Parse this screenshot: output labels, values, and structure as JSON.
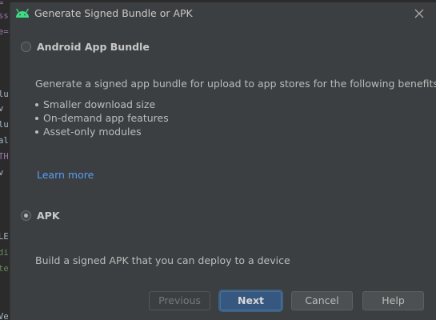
{
  "editor": {
    "fragments": [
      "=",
      "ss",
      "e=",
      "lu",
      "v",
      "lu",
      "al",
      "TH",
      "v",
      "LE",
      "di",
      "te",
      "Ve"
    ]
  },
  "dialog": {
    "title": "Generate Signed Bundle or APK",
    "options": [
      {
        "label": "Android App Bundle",
        "selected": false,
        "description": "Generate a signed app bundle for upload to app stores for the following benefits:",
        "benefits": [
          "Smaller download size",
          "On-demand app features",
          "Asset-only modules"
        ],
        "link": "Learn more"
      },
      {
        "label": "APK",
        "selected": true,
        "description": "Build a signed APK that you can deploy to a device"
      }
    ],
    "buttons": {
      "previous": "Previous",
      "next": "Next",
      "cancel": "Cancel",
      "help": "Help"
    }
  },
  "colors": {
    "dialog_bg": "#3c3f41",
    "link": "#589df6",
    "primary_button": "#365880",
    "android_green": "#3ddc84"
  }
}
